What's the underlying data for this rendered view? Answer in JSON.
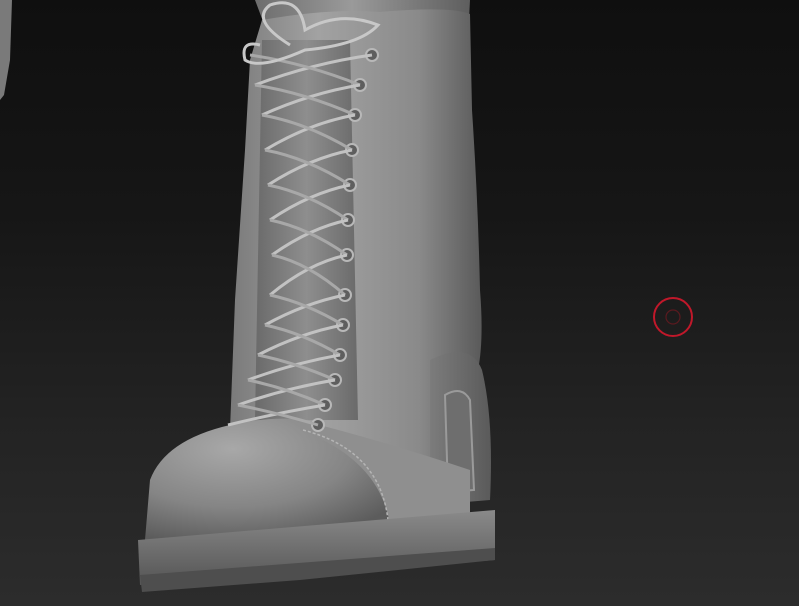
{
  "viewport": {
    "subject": "boot-sculpt",
    "background_top": "#0f0f0f",
    "background_bottom": "#2c2c2c",
    "model_color": "#8c8c8c"
  },
  "cursor": {
    "icon": "brush-circle-icon",
    "color": "#c0182a"
  }
}
